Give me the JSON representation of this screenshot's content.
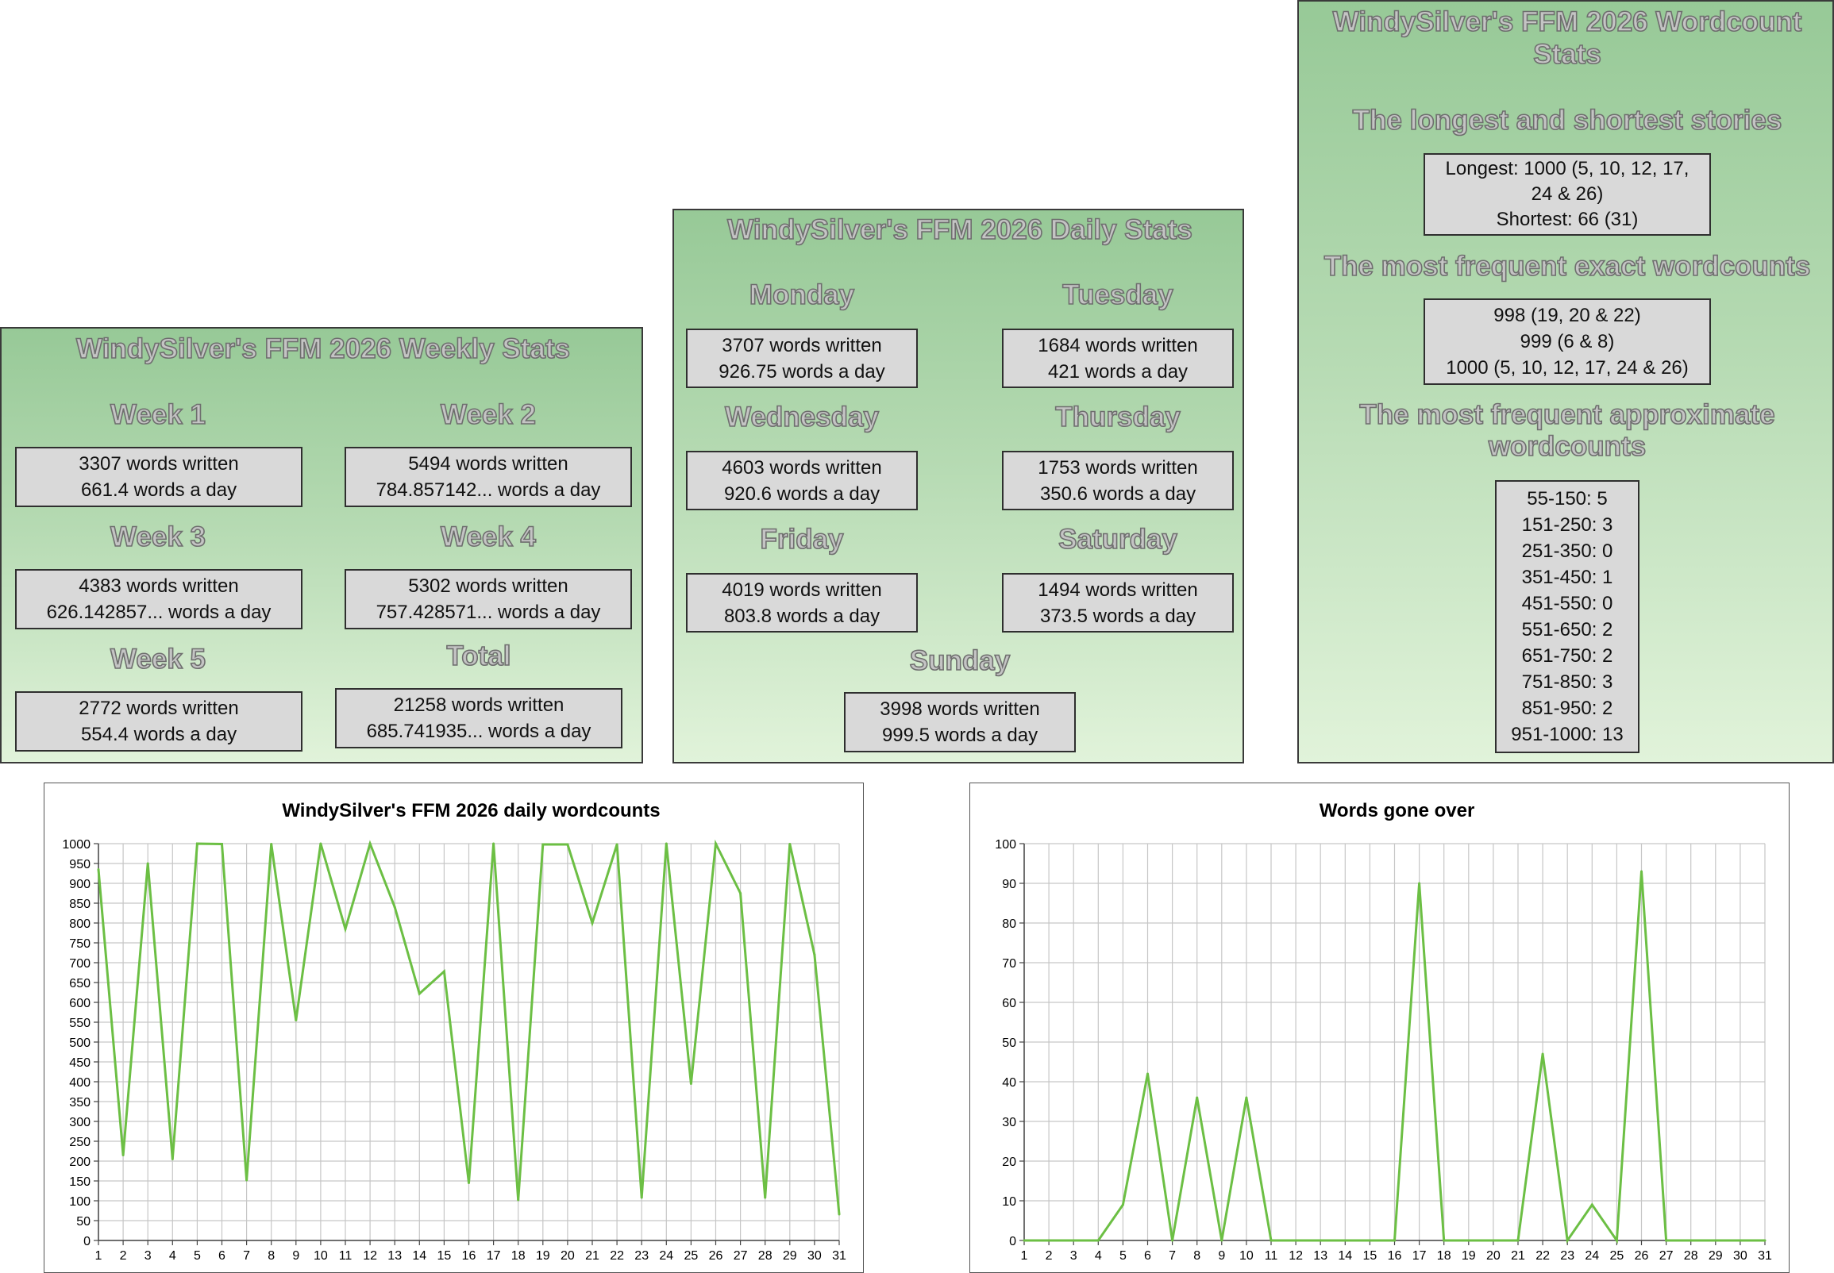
{
  "weekly": {
    "title": "WindySilver's FFM 2026 Weekly Stats",
    "items": [
      {
        "label": "Week 1",
        "written": "3307 words written",
        "per_day": "661.4 words a day"
      },
      {
        "label": "Week 2",
        "written": "5494 words written",
        "per_day": "784.857142... words a day"
      },
      {
        "label": "Week 3",
        "written": "4383 words written",
        "per_day": "626.142857... words a day"
      },
      {
        "label": "Week 4",
        "written": "5302 words written",
        "per_day": "757.428571... words a day"
      },
      {
        "label": "Week 5",
        "written": "2772 words written",
        "per_day": "554.4 words a day"
      },
      {
        "label": "Total",
        "written": "21258 words written",
        "per_day": "685.741935... words a day"
      }
    ]
  },
  "daily": {
    "title": "WindySilver's FFM 2026 Daily Stats",
    "items": [
      {
        "label": "Monday",
        "written": "3707 words written",
        "per_day": "926.75 words a day"
      },
      {
        "label": "Tuesday",
        "written": "1684 words written",
        "per_day": "421 words a day"
      },
      {
        "label": "Wednesday",
        "written": "4603 words written",
        "per_day": "920.6 words a day"
      },
      {
        "label": "Thursday",
        "written": "1753 words written",
        "per_day": "350.6 words a day"
      },
      {
        "label": "Friday",
        "written": "4019 words written",
        "per_day": "803.8 words a day"
      },
      {
        "label": "Saturday",
        "written": "1494 words written",
        "per_day": "373.5 words a day"
      },
      {
        "label": "Sunday",
        "written": "3998 words written",
        "per_day": "999.5 words a day"
      }
    ]
  },
  "wordcount": {
    "title_line1": "WindySilver's FFM 2026 Wordcount",
    "title_line2": "Stats",
    "longest_heading": "The longest and shortest stories",
    "longest_line1": "Longest: 1000 (5, 10, 12, 17,",
    "longest_line2": "24 & 26)",
    "shortest": "Shortest: 66 (31)",
    "frequent_heading": "The most frequent exact wordcounts",
    "frequent": [
      "998 (19, 20 & 22)",
      "999 (6 & 8)",
      "1000 (5, 10, 12, 17, 24 & 26)"
    ],
    "approx_heading_line1": "The most frequent approximate",
    "approx_heading_line2": "wordcounts",
    "approx": [
      "55-150: 5",
      "151-250: 3",
      "251-350: 0",
      "351-450: 1",
      "451-550: 0",
      "551-650: 2",
      "651-750: 2",
      "751-850: 3",
      "851-950: 2",
      "951-1000: 13"
    ]
  },
  "chart_data": [
    {
      "type": "line",
      "title": "WindySilver's FFM 2026 daily wordcounts",
      "x": [
        1,
        2,
        3,
        4,
        5,
        6,
        7,
        8,
        9,
        10,
        11,
        12,
        13,
        14,
        15,
        16,
        17,
        18,
        19,
        20,
        21,
        22,
        23,
        24,
        25,
        26,
        27,
        28,
        29,
        30,
        31
      ],
      "series": [
        {
          "values": [
            935,
            215,
            950,
            205,
            1000,
            999,
            152,
            999,
            555,
            1000,
            785,
            1000,
            840,
            622,
            678,
            145,
            1000,
            102,
            998,
            998,
            800,
            998,
            108,
            1000,
            395,
            1000,
            875,
            108,
            999,
            720,
            66
          ]
        }
      ],
      "xlabel": "",
      "ylabel": "",
      "ylim": [
        0,
        1000
      ],
      "yticks": [
        0,
        50,
        100,
        150,
        200,
        250,
        300,
        350,
        400,
        450,
        500,
        550,
        600,
        650,
        700,
        750,
        800,
        850,
        900,
        950,
        1000
      ],
      "grid": true,
      "color": "#6cbf44"
    },
    {
      "type": "line",
      "title": "Words gone over",
      "x": [
        1,
        2,
        3,
        4,
        5,
        6,
        7,
        8,
        9,
        10,
        11,
        12,
        13,
        14,
        15,
        16,
        17,
        18,
        19,
        20,
        21,
        22,
        23,
        24,
        25,
        26,
        27,
        28,
        29,
        30,
        31
      ],
      "series": [
        {
          "values": [
            0,
            0,
            0,
            0,
            9,
            42,
            0,
            36,
            0,
            36,
            0,
            0,
            0,
            0,
            0,
            0,
            90,
            0,
            0,
            0,
            0,
            47,
            0,
            9,
            0,
            93,
            0,
            0,
            0,
            0,
            0
          ]
        }
      ],
      "xlabel": "",
      "ylabel": "",
      "ylim": [
        0,
        100
      ],
      "yticks": [
        0,
        10,
        20,
        30,
        40,
        50,
        60,
        70,
        80,
        90,
        100
      ],
      "grid": true,
      "color": "#6cbf44"
    }
  ]
}
